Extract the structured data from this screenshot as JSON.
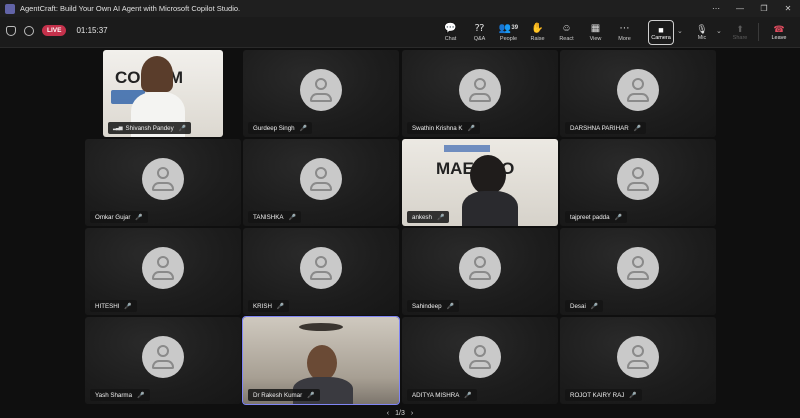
{
  "window": {
    "title": "AgentCraft: Build Your Own AI Agent with Microsoft Copilot Studio.",
    "controls": [
      "⋯",
      "—",
      "❐",
      "✕"
    ]
  },
  "toolbar": {
    "live_label": "LIVE",
    "timer": "01:15:37",
    "actions": [
      {
        "label": "Chat",
        "icon": "chat-icon",
        "glyph": "💬"
      },
      {
        "label": "Q&A",
        "icon": "qa-icon",
        "glyph": "⁇"
      },
      {
        "label": "People",
        "icon": "people-icon",
        "glyph": "👥",
        "count": "39"
      },
      {
        "label": "Raise",
        "icon": "hand-icon",
        "glyph": "✋"
      },
      {
        "label": "React",
        "icon": "smile-icon",
        "glyph": "☺"
      },
      {
        "label": "View",
        "icon": "grid-icon",
        "glyph": "▦"
      },
      {
        "label": "More",
        "icon": "more-icon",
        "glyph": "⋯"
      }
    ],
    "camera_label": "Camera",
    "mic_label": "Mic",
    "share_label": "Share",
    "leave_label": "Leave"
  },
  "participants": [
    {
      "name": "Shivansh Pandey",
      "video": true
    },
    {
      "name": "Gurdeep Singh",
      "video": false
    },
    {
      "name": "Swathin Krishna K",
      "video": false
    },
    {
      "name": "DARSHNA PARIHAR",
      "video": false
    },
    {
      "name": "Omkar Gujar",
      "video": false
    },
    {
      "name": "TANISHKA",
      "video": false
    },
    {
      "name": "ankesh",
      "video": true
    },
    {
      "name": "tajpreet padda",
      "video": false
    },
    {
      "name": "HITESHI",
      "video": false
    },
    {
      "name": "KRISH",
      "video": false
    },
    {
      "name": "Sahindeep",
      "video": false
    },
    {
      "name": "Desai",
      "video": false
    },
    {
      "name": "Yash Sharma",
      "video": false
    },
    {
      "name": "Dr Rakesh Kumar",
      "video": true
    },
    {
      "name": "ADITYA MISHRA",
      "video": false
    },
    {
      "name": "ROJOT KAIRY RAJ",
      "video": false
    }
  ],
  "video_overlays": {
    "shivansh_banner": "CO    EAM",
    "ankesh_banner": "MAET  CO"
  },
  "pager": {
    "text": "1/3",
    "prev": "‹",
    "next": "›"
  }
}
